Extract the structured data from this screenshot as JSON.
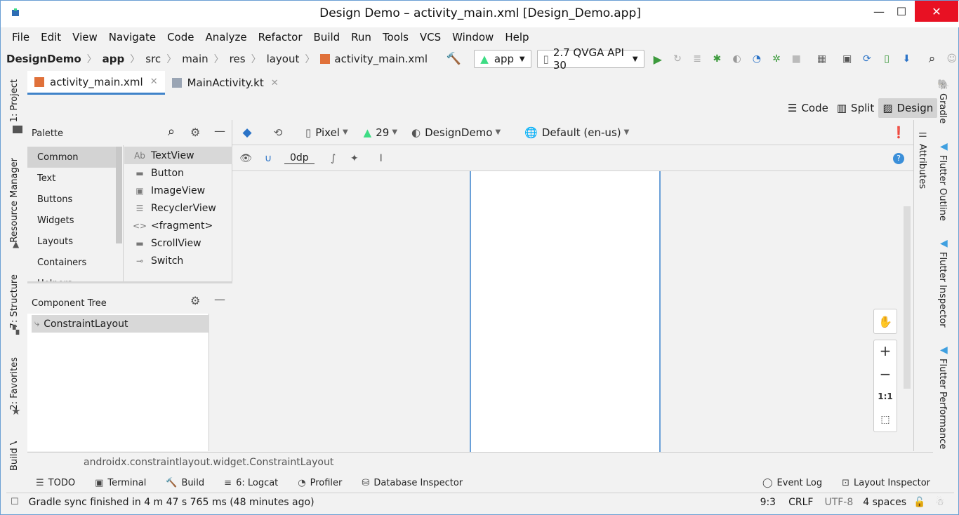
{
  "window": {
    "title": "Design Demo – activity_main.xml [Design_Demo.app]"
  },
  "menu": [
    "File",
    "Edit",
    "View",
    "Navigate",
    "Code",
    "Analyze",
    "Refactor",
    "Build",
    "Run",
    "Tools",
    "VCS",
    "Window",
    "Help"
  ],
  "breadcrumb": [
    "DesignDemo",
    "app",
    "src",
    "main",
    "res",
    "layout",
    "activity_main.xml"
  ],
  "run_config": {
    "module": "app",
    "device": "2.7  QVGA API 30"
  },
  "editor_tabs": [
    {
      "label": "activity_main.xml"
    },
    {
      "label": "MainActivity.kt"
    }
  ],
  "view_modes": {
    "code": "Code",
    "split": "Split",
    "design": "Design"
  },
  "palette": {
    "title": "Palette",
    "categories": [
      "Common",
      "Text",
      "Buttons",
      "Widgets",
      "Layouts",
      "Containers",
      "Helpers"
    ],
    "widgets": [
      {
        "label": "TextView",
        "icon": "Ab"
      },
      {
        "label": "Button",
        "icon": "▬"
      },
      {
        "label": "ImageView",
        "icon": "▣"
      },
      {
        "label": "RecyclerView",
        "icon": "☰"
      },
      {
        "label": "<fragment>",
        "icon": "<>"
      },
      {
        "label": "ScrollView",
        "icon": "▬"
      },
      {
        "label": "Switch",
        "icon": "⊸"
      }
    ]
  },
  "component_tree": {
    "title": "Component Tree",
    "root": "ConstraintLayout"
  },
  "design_toolbar": {
    "device": "Pixel",
    "api": "29",
    "theme": "DesignDemo",
    "locale": "Default (en-us)",
    "margin": "0dp"
  },
  "left_tool_tabs": [
    "1: Project",
    "Resource Manager",
    "7: Structure",
    "2: Favorites",
    "Build Variants"
  ],
  "right_tool_tabs": [
    "Gradle",
    "Flutter Outline",
    "Flutter Inspector",
    "Flutter Performance"
  ],
  "attributes_tab": "Attributes",
  "zoom": {
    "one_to_one": "1:1"
  },
  "path": "androidx.constraintlayout.widget.ConstraintLayout",
  "tool_windows": [
    {
      "label": "TODO",
      "icon": "☰"
    },
    {
      "label": "Terminal",
      "icon": "▣"
    },
    {
      "label": "Build",
      "icon": "🔨"
    },
    {
      "label": "6: Logcat",
      "icon": "≡"
    },
    {
      "label": "Profiler",
      "icon": "◔"
    },
    {
      "label": "Database Inspector",
      "icon": "⛁"
    }
  ],
  "right_tool_windows": [
    {
      "label": "Event Log"
    },
    {
      "label": "Layout Inspector"
    }
  ],
  "status": {
    "message": "Gradle sync finished in 4 m 47 s 765 ms (48 minutes ago)",
    "position": "9:3",
    "line_sep": "CRLF",
    "encoding": "UTF-8",
    "indent": "4 spaces"
  }
}
